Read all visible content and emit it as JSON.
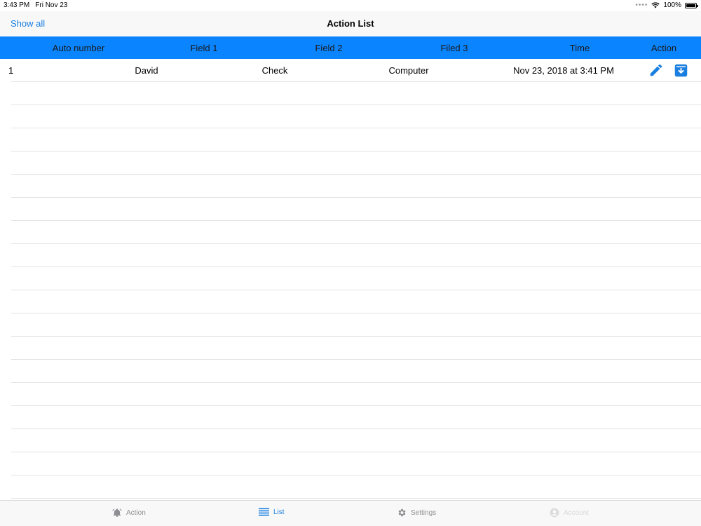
{
  "status": {
    "time": "3:43 PM",
    "date": "Fri Nov 23",
    "battery": "100%",
    "battery_level": 1.0
  },
  "nav": {
    "left_button": "Show all",
    "title": "Action List"
  },
  "table": {
    "columns": [
      "Auto number",
      "Field 1",
      "Field 2",
      "Filed 3",
      "Time",
      "Action"
    ],
    "rows": [
      {
        "auto_number": "1",
        "field1": "David",
        "field2": "Check",
        "field3": "Computer",
        "time": "Nov 23, 2018 at 3:41 PM"
      }
    ]
  },
  "tabs": [
    {
      "label": "Action",
      "icon": "alarm-bell-icon",
      "state": "normal"
    },
    {
      "label": "List",
      "icon": "list-icon",
      "state": "active"
    },
    {
      "label": "Settings",
      "icon": "gear-icon",
      "state": "normal"
    },
    {
      "label": "Account",
      "icon": "person-icon",
      "state": "disabled"
    }
  ],
  "colors": {
    "accent": "#0a84ff",
    "link": "#1a7fe0",
    "tab_inactive": "#8e8e93"
  }
}
